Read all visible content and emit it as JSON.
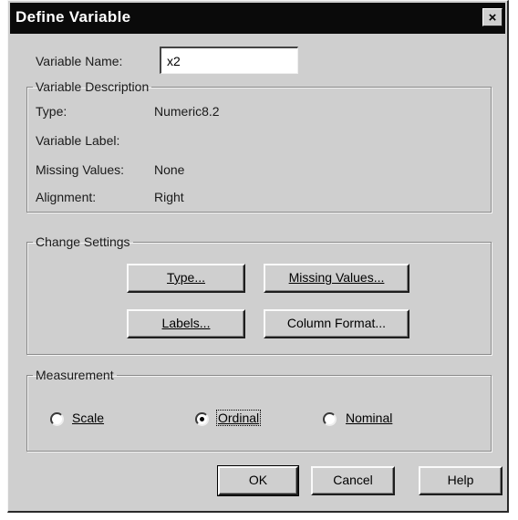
{
  "dialog": {
    "title": "Define Variable",
    "close_symbol": "×"
  },
  "variable_name": {
    "label": "Variable Name:",
    "value": "x2"
  },
  "variable_description": {
    "legend": "Variable Description",
    "type_label": "Type:",
    "type_value": "Numeric8.2",
    "variable_label_label": "Variable Label:",
    "missing_values_label": "Missing Values:",
    "missing_values_value": "None",
    "alignment_label": "Alignment:",
    "alignment_value": "Right"
  },
  "change_settings": {
    "legend": "Change Settings",
    "type_button": "Type...",
    "missing_values_button": "Missing Values...",
    "labels_button": "Labels...",
    "column_format_button": "Column Format..."
  },
  "measurement": {
    "legend": "Measurement",
    "options": [
      {
        "label": "Scale",
        "selected": false
      },
      {
        "label": "Ordinal",
        "selected": true
      },
      {
        "label": "Nominal",
        "selected": false
      }
    ]
  },
  "footer": {
    "ok_label": "OK",
    "cancel_label": "Cancel",
    "help_label": "Help"
  }
}
